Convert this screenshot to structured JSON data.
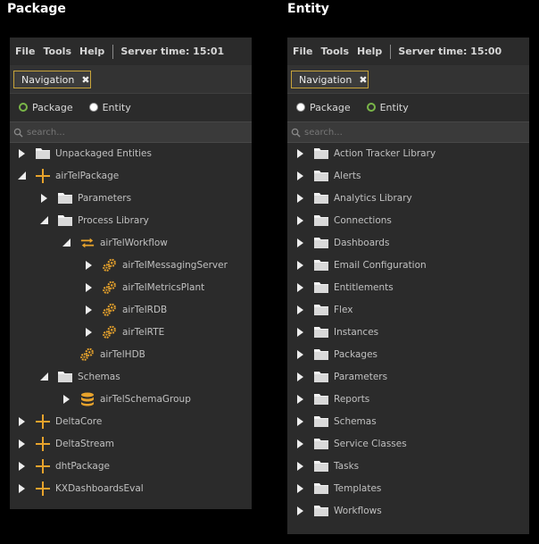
{
  "headings": {
    "left": "Package",
    "right": "Entity"
  },
  "left_panel": {
    "menu": [
      "File",
      "Tools",
      "Help"
    ],
    "server_time": "Server time: 15:01",
    "tab_label": "Navigation",
    "tab_close": "✖",
    "radio_package": "Package",
    "radio_entity": "Entity",
    "selected": "Package",
    "search_placeholder": "search...",
    "tree": [
      {
        "label": "Unpackaged Entities",
        "level": 0,
        "arrow": "right",
        "icon": "folder-icon"
      },
      {
        "label": "airTelPackage",
        "level": 0,
        "arrow": "down",
        "icon": "package-plus-icon"
      },
      {
        "label": "Parameters",
        "level": 1,
        "arrow": "right",
        "icon": "folder-icon"
      },
      {
        "label": "Process Library",
        "level": 1,
        "arrow": "down",
        "icon": "folder-icon"
      },
      {
        "label": "airTelWorkflow",
        "level": 2,
        "arrow": "down",
        "icon": "workflow-icon"
      },
      {
        "label": "airTelMessagingServer",
        "level": 3,
        "arrow": "right",
        "icon": "gears-icon"
      },
      {
        "label": "airTelMetricsPlant",
        "level": 3,
        "arrow": "right",
        "icon": "gears-icon"
      },
      {
        "label": "airTelRDB",
        "level": 3,
        "arrow": "right",
        "icon": "gears-icon"
      },
      {
        "label": "airTelRTE",
        "level": 3,
        "arrow": "right",
        "icon": "gears-icon"
      },
      {
        "label": "airTelHDB",
        "level": 2,
        "arrow": "none",
        "icon": "gears-icon"
      },
      {
        "label": "Schemas",
        "level": 1,
        "arrow": "down",
        "icon": "folder-icon"
      },
      {
        "label": "airTelSchemaGroup",
        "level": 2,
        "arrow": "right",
        "icon": "database-icon"
      },
      {
        "label": "DeltaCore",
        "level": 0,
        "arrow": "right",
        "icon": "package-plus-icon"
      },
      {
        "label": "DeltaStream",
        "level": 0,
        "arrow": "right",
        "icon": "package-plus-icon"
      },
      {
        "label": "dhtPackage",
        "level": 0,
        "arrow": "right",
        "icon": "package-plus-icon"
      },
      {
        "label": "KXDashboardsEval",
        "level": 0,
        "arrow": "right",
        "icon": "package-plus-icon"
      }
    ]
  },
  "right_panel": {
    "menu": [
      "File",
      "Tools",
      "Help"
    ],
    "server_time": "Server time: 15:00",
    "tab_label": "Navigation",
    "tab_close": "✖",
    "radio_package": "Package",
    "radio_entity": "Entity",
    "selected": "Entity",
    "search_placeholder": "search...",
    "tree": [
      {
        "label": "Action Tracker Library",
        "level": 0,
        "arrow": "right",
        "icon": "folder-icon"
      },
      {
        "label": "Alerts",
        "level": 0,
        "arrow": "right",
        "icon": "folder-icon"
      },
      {
        "label": "Analytics Library",
        "level": 0,
        "arrow": "right",
        "icon": "folder-icon"
      },
      {
        "label": "Connections",
        "level": 0,
        "arrow": "right",
        "icon": "folder-icon"
      },
      {
        "label": "Dashboards",
        "level": 0,
        "arrow": "right",
        "icon": "folder-icon"
      },
      {
        "label": "Email Configuration",
        "level": 0,
        "arrow": "right",
        "icon": "folder-icon"
      },
      {
        "label": "Entitlements",
        "level": 0,
        "arrow": "right",
        "icon": "folder-icon"
      },
      {
        "label": "Flex",
        "level": 0,
        "arrow": "right",
        "icon": "folder-icon"
      },
      {
        "label": "Instances",
        "level": 0,
        "arrow": "right",
        "icon": "folder-icon"
      },
      {
        "label": "Packages",
        "level": 0,
        "arrow": "right",
        "icon": "folder-icon"
      },
      {
        "label": "Parameters",
        "level": 0,
        "arrow": "right",
        "icon": "folder-icon"
      },
      {
        "label": "Reports",
        "level": 0,
        "arrow": "right",
        "icon": "folder-icon"
      },
      {
        "label": "Schemas",
        "level": 0,
        "arrow": "right",
        "icon": "folder-icon"
      },
      {
        "label": "Service Classes",
        "level": 0,
        "arrow": "right",
        "icon": "folder-icon"
      },
      {
        "label": "Tasks",
        "level": 0,
        "arrow": "right",
        "icon": "folder-icon"
      },
      {
        "label": "Templates",
        "level": 0,
        "arrow": "right",
        "icon": "folder-icon"
      },
      {
        "label": "Workflows",
        "level": 0,
        "arrow": "right",
        "icon": "folder-icon"
      }
    ]
  },
  "colors": {
    "accent": "#e8a32c",
    "radio_selected": "#7ab648",
    "tab_border": "#c8a43a"
  }
}
